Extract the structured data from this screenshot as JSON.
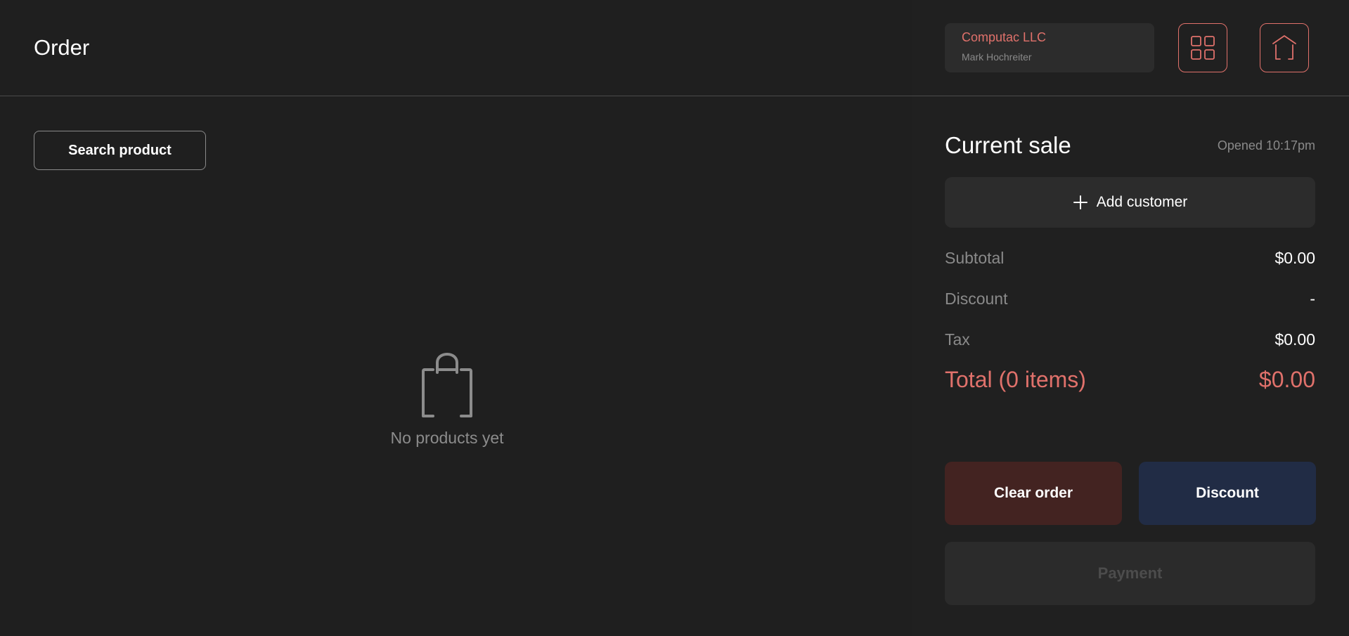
{
  "header": {
    "title": "Order"
  },
  "main": {
    "search_label": "Search product",
    "empty_text": "No products yet",
    "empty_icon": "shopping-bag-icon"
  },
  "account": {
    "company": "Computac LLC",
    "user": "Mark Hochreiter"
  },
  "toolbar": {
    "grid_icon": "grid-icon",
    "home_icon": "home-icon"
  },
  "sale": {
    "title": "Current sale",
    "opened": "Opened 10:17pm",
    "add_customer_label": "Add customer",
    "add_customer_icon": "plus-icon",
    "subtotal_label": "Subtotal",
    "subtotal_value": "$0.00",
    "discount_label": "Discount",
    "discount_value": "-",
    "tax_label": "Tax",
    "tax_value": "$0.00",
    "total_label": "Total (0 items)",
    "total_value": "$0.00"
  },
  "actions": {
    "clear_label": "Clear order",
    "discount_label": "Discount",
    "payment_label": "Payment"
  },
  "colors": {
    "accent": "#e0716b",
    "background": "#1f1f1f",
    "card": "#2c2c2c",
    "clear_button": "#432321",
    "discount_button": "#212c45",
    "payment_button": "#2b2b2b"
  }
}
